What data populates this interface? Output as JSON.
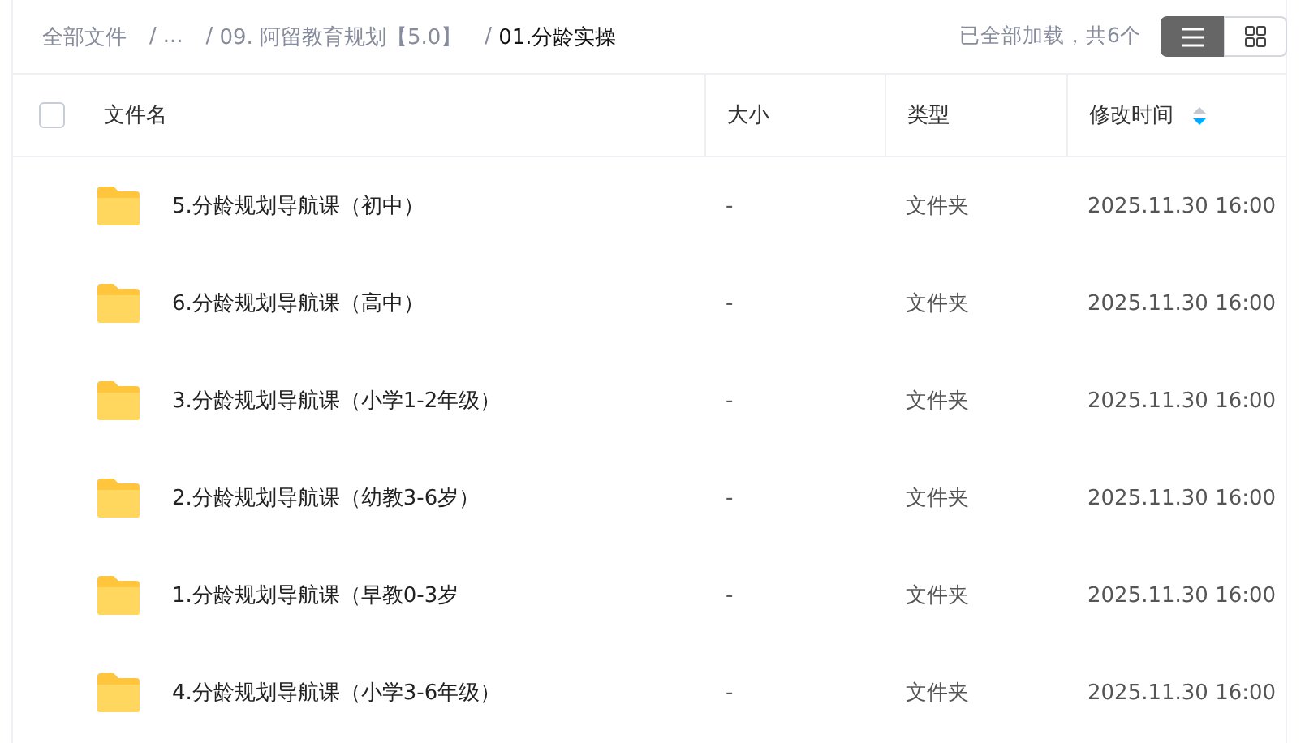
{
  "breadcrumb": [
    {
      "label": "全部文件",
      "current": false
    },
    {
      "label": "...",
      "current": false
    },
    {
      "label": "09. 阿留教育规划【5.0】",
      "current": false
    },
    {
      "label": "01.分龄实操",
      "current": true
    }
  ],
  "breadcrumb_separator": "/",
  "status": "已全部加载，共6个",
  "view_buttons": [
    {
      "kind": "list",
      "selected": true
    },
    {
      "kind": "grid",
      "selected": false
    }
  ],
  "select_all": {
    "checked": false
  },
  "columns": [
    {
      "label": "文件名",
      "sortable": false
    },
    {
      "label": "大小",
      "sortable": false
    },
    {
      "label": "类型",
      "sortable": false
    },
    {
      "label": "修改时间",
      "sortable": true
    }
  ],
  "rows": [
    {
      "name": "5.分龄规划导航课（初中）",
      "size": "-",
      "type": "文件夹",
      "modified": "2025.11.30 16:00"
    },
    {
      "name": "6.分龄规划导航课（高中）",
      "size": "-",
      "type": "文件夹",
      "modified": "2025.11.30 16:00"
    },
    {
      "name": "3.分龄规划导航课（小学1-2年级）",
      "size": "-",
      "type": "文件夹",
      "modified": "2025.11.30 16:00"
    },
    {
      "name": "2.分龄规划导航课（幼教3-6岁）",
      "size": "-",
      "type": "文件夹",
      "modified": "2025.11.30 16:00"
    },
    {
      "name": "1.分龄规划导航课（早教0-3岁",
      "size": "-",
      "type": "文件夹",
      "modified": "2025.11.30 16:00"
    },
    {
      "name": "4.分龄规划导航课（小学3-6年级）",
      "size": "-",
      "type": "文件夹",
      "modified": "2025.11.30 16:00"
    }
  ]
}
